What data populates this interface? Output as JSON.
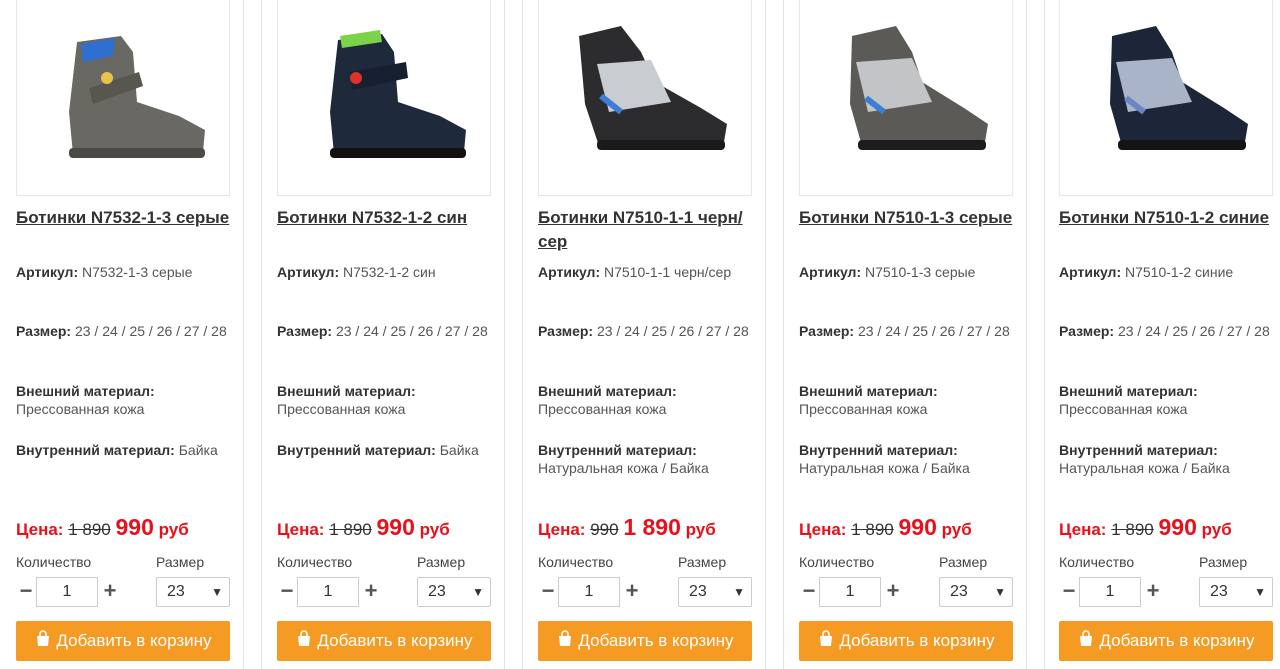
{
  "labels": {
    "article": "Артикул:",
    "size": "Размер:",
    "outer": "Внешний материал:",
    "inner": "Внутренний материал:",
    "price": "Цена:",
    "currency": "руб",
    "quantity": "Количество",
    "size_select": "Размер",
    "add_to_cart": "Добавить в корзину"
  },
  "colors": {
    "price_red": "#e8101b",
    "button_orange": "#f59a23"
  },
  "icons": {
    "cart": "shopping-bag-icon",
    "minus": "minus-icon",
    "plus": "plus-icon",
    "dropdown": "chevron-down-icon"
  },
  "products": [
    {
      "title": "Ботинки N7532-1-3 серые",
      "article": "N7532-1-3 серые",
      "sizes": "23 / 24 / 25 / 26 / 27 / 28",
      "outer": "Прессованная кожа",
      "inner": "Байка",
      "old_price": "1 890",
      "new_price": "990",
      "qty": "1",
      "size_selected": "23",
      "shoe_color": "#6a6862",
      "accent": "#2f6fd0"
    },
    {
      "title": "Ботинки N7532-1-2 син",
      "article": "N7532-1-2 син",
      "sizes": "23 / 24 / 25 / 26 / 27 / 28",
      "outer": "Прессованная кожа",
      "inner": "Байка",
      "old_price": "1 890",
      "new_price": "990",
      "qty": "1",
      "size_selected": "23",
      "shoe_color": "#1e2a3c",
      "accent": "#7bd34a"
    },
    {
      "title": "Ботинки N7510-1-1 черн/сер",
      "article": "N7510-1-1 черн/сер",
      "sizes": "23 / 24 / 25 / 26 / 27 / 28",
      "outer": "Прессованная кожа",
      "inner": "Натуральная кожа / Байка",
      "old_price": "990",
      "new_price": "1 890",
      "qty": "1",
      "size_selected": "23",
      "shoe_color": "#2c2c2e",
      "accent": "#3a7fd5"
    },
    {
      "title": "Ботинки N7510-1-3 серые",
      "article": "N7510-1-3 серые",
      "sizes": "23 / 24 / 25 / 26 / 27 / 28",
      "outer": "Прессованная кожа",
      "inner": "Натуральная кожа / Байка",
      "old_price": "1 890",
      "new_price": "990",
      "qty": "1",
      "size_selected": "23",
      "shoe_color": "#5b5a56",
      "accent": "#3a7fd5"
    },
    {
      "title": "Ботинки N7510-1-2 синие",
      "article": "N7510-1-2 синие",
      "sizes": "23 / 24 / 25 / 26 / 27 / 28",
      "outer": "Прессованная кожа",
      "inner": "Натуральная кожа / Байка",
      "old_price": "1 890",
      "new_price": "990",
      "qty": "1",
      "size_selected": "23",
      "shoe_color": "#1d2538",
      "accent": "#6b86c6"
    }
  ]
}
